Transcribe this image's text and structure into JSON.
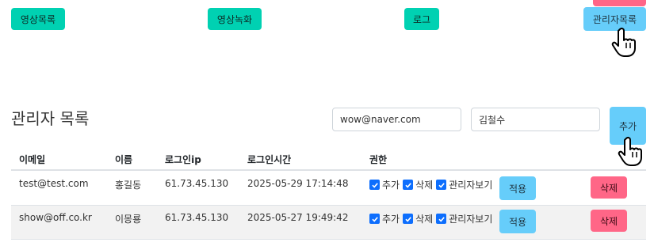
{
  "nav": {
    "video_list": "영상목록",
    "video_record": "영상녹화",
    "log": "로그",
    "admin_list": "관리자목록"
  },
  "page": {
    "title": "관리자 목록"
  },
  "form": {
    "email_value": "wow@naver.com",
    "name_value": "김철수",
    "add_label": "추가"
  },
  "table": {
    "headers": [
      "이메일",
      "이름",
      "로그인ip",
      "로그인시간",
      "권한"
    ],
    "rows": [
      {
        "email": "test@test.com",
        "name": "홍길동",
        "ip": "61.73.45.130",
        "time": "2025-05-29 17:14:48",
        "permissions": [
          {
            "label": "추가",
            "checked": true
          },
          {
            "label": "삭제",
            "checked": true
          },
          {
            "label": "관리자보기",
            "checked": true
          }
        ],
        "apply_label": "적용",
        "delete_label": "삭제"
      },
      {
        "email": "show@off.co.kr",
        "name": "이몽룡",
        "ip": "61.73.45.130",
        "time": "2025-05-27 19:49:42",
        "permissions": [
          {
            "label": "추가",
            "checked": true
          },
          {
            "label": "삭제",
            "checked": true
          },
          {
            "label": "관리자보기",
            "checked": true
          }
        ],
        "apply_label": "적용",
        "delete_label": "삭제"
      }
    ]
  },
  "colors": {
    "nav_button": "#00d1b2",
    "info_button": "#66cdfa",
    "danger_button": "#ff6687",
    "checkbox": "#0d6efd",
    "row_alt_bg": "#f2f2f2"
  },
  "icons": [
    "hand-pointer-cursor-icon",
    "checkbox-checked-icon"
  ]
}
